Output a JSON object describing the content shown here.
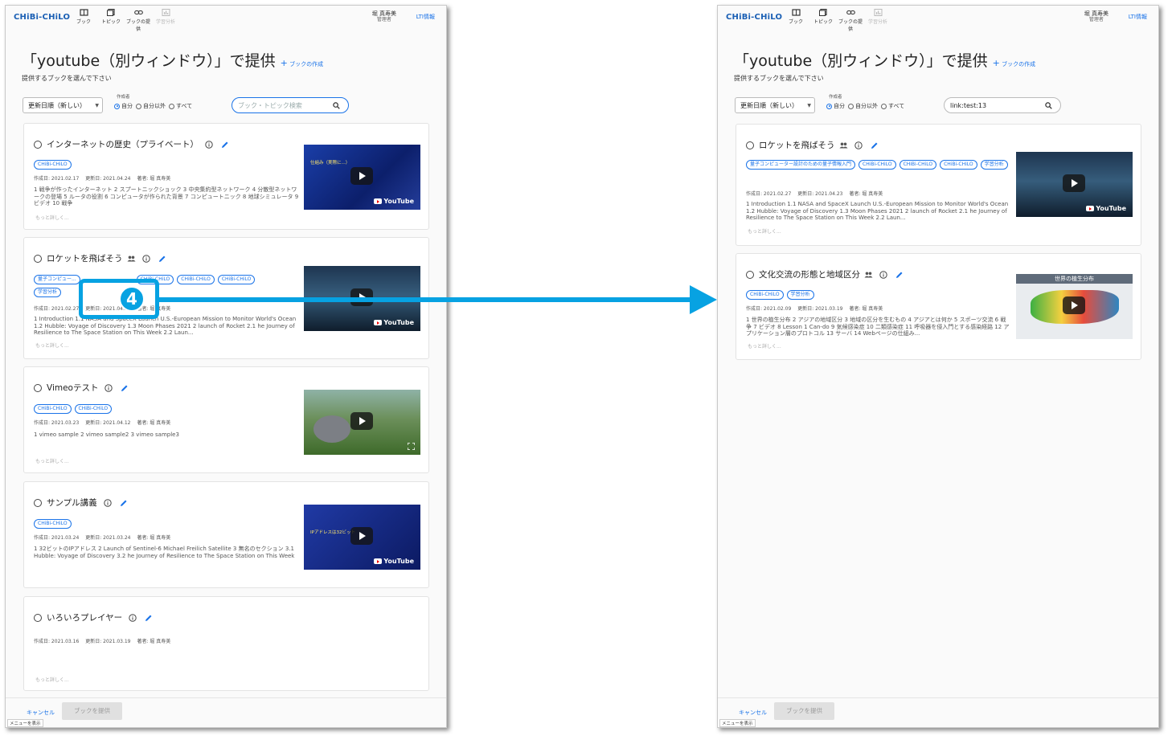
{
  "app": {
    "logo": "CHiBi-CHiLO",
    "nav": [
      {
        "label": "ブック",
        "icon": "book-icon",
        "enabled": true
      },
      {
        "label": "トピック",
        "icon": "topic-icon",
        "enabled": true
      },
      {
        "label": "ブックの提供",
        "icon": "link-icon",
        "enabled": true
      },
      {
        "label": "学習分析",
        "icon": "analytics-icon",
        "enabled": false
      }
    ],
    "user_name": "堀 真寿美",
    "user_role": "管理者",
    "lti_link": "LTI情報"
  },
  "page": {
    "title": "「youtube（別ウィンドウ）」で提供",
    "create_label": "ブックの作成",
    "subtitle": "提供するブックを選んで下さい"
  },
  "filters": {
    "sort_value": "更新日順（新しい）",
    "author_label": "作成者",
    "author_options": [
      "自分",
      "自分以外",
      "すべて"
    ],
    "author_selected": "自分",
    "search_placeholder": "ブック・トピック検索"
  },
  "left": {
    "search_value": "",
    "cards": [
      {
        "title": "インターネットの歴史（プライベート）",
        "tags": [
          "CHiBi-CHiLO"
        ],
        "created": "作成日: 2021.02.17",
        "updated": "更新日: 2021.04.24",
        "author": "著者: 堀 真寿美",
        "desc": "1 戦争が作ったインターネット 2 スプートニックショック 3 中央集約型ネットワーク 4 分散型ネットワークの登場 5 ルータの役割 6 コンピュータが作られた背景 7 コンピュートニック 8 地球シミュレータ 9 ビデオ 10 戦争",
        "more": "もっと詳しく...",
        "thumb_text": "仕組み（実際に...）",
        "video": "YouTube"
      },
      {
        "title": "ロケットを飛ばそう",
        "tags": [
          "量子コンピュー...",
          "CHiBi-CHiLO",
          "CHiBi-CHiLO",
          "CHiBi-CHiLO",
          "学習分析"
        ],
        "created": "作成日: 2021.02.27",
        "updated": "更新日: 2021.04.23",
        "author": "著者: 堀 真寿美",
        "desc": "1 Introduction 1.1 NASA and SpaceX Launch U.S.-European Mission to Monitor World's Ocean 1.2 Hubble: Voyage of Discovery 1.3 Moon Phases 2021 2 launch of Rocket 2.1 he Journey of Resilience to The Space Station on This Week 2.2 Laun...",
        "more": "もっと詳しく...",
        "video": "YouTube"
      },
      {
        "title": "Vimeoテスト",
        "tags": [
          "CHiBi-CHiLO",
          "CHiBi-CHiLO"
        ],
        "created": "作成日: 2021.03.23",
        "updated": "更新日: 2021.04.12",
        "author": "著者: 堀 真寿美",
        "desc": "1 vimeo sample 2 vimeo sample2 3 vimeo sample3",
        "more": "もっと詳しく..."
      },
      {
        "title": "サンプル講義",
        "tags": [
          "CHiBi-CHiLO"
        ],
        "created": "作成日: 2021.03.24",
        "updated": "更新日: 2021.03.24",
        "author": "著者: 堀 真寿美",
        "desc": "1 32ビットのIPアドレス 2 Launch of Sentinel-6 Michael Freilich Satellite 3 無名のセクション 3.1 Hubble: Voyage of Discovery 3.2 he Journey of Resilience to The Space Station on This Week",
        "more": "もっと詳しく...",
        "thumb_text": "IPアドレスは32ビット",
        "video": "YouTube"
      },
      {
        "title": "いろいろプレイヤー",
        "tags": [],
        "created": "作成日: 2021.03.16",
        "updated": "更新日: 2021.03.19",
        "author": "著者: 堀 真寿美",
        "desc": "",
        "more": "もっと詳しく..."
      }
    ]
  },
  "right": {
    "search_value": "link:test:13",
    "cards": [
      {
        "title": "ロケットを飛ばそう",
        "tags": [
          "量子コンピューター設計のための量子情報入門",
          "CHiBi-CHiLO",
          "CHiBi-CHiLO",
          "CHiBi-CHiLO",
          "学習分析"
        ],
        "created": "作成日: 2021.02.27",
        "updated": "更新日: 2021.04.23",
        "author": "著者: 堀 真寿美",
        "desc": "1 Introduction 1.1 NASA and SpaceX Launch U.S.-European Mission to Monitor World's Ocean 1.2 Hubble: Voyage of Discovery 1.3 Moon Phases 2021 2 launch of Rocket 2.1 he Journey of Resilience to The Space Station on This Week 2.2 Laun...",
        "more": "もっと詳しく...",
        "video": "YouTube"
      },
      {
        "title": "文化交流の形態と地域区分",
        "tags": [
          "CHiBi-CHiLO",
          "学習分析"
        ],
        "created": "作成日: 2021.02.09",
        "updated": "更新日: 2021.03.19",
        "author": "著者: 堀 真寿美",
        "desc": "1 世界の植生分布 2 アジアの地域区分 3 地域の区分を生むもの 4 アジアとは何か 5 スポーツ交流 6 戦争 7 ビデオ 8 Lesson 1 Can-do 9 気候感染症 10 二類感染症 11 呼吸器を侵入門とする感染経路 12 アプリケーション層のプロトコル 13 サーバ 14 Webページの仕組み...",
        "more": "もっと詳しく...",
        "thumb_text": "世界の植生分布"
      }
    ]
  },
  "footer": {
    "cancel": "キャンセル",
    "provide": "ブックを提供",
    "menu_tip": "メニューを表示"
  },
  "annotation": {
    "step": "4",
    "color": "#07a2e2"
  },
  "colors": {
    "accent": "#1a73e8",
    "brand": "#1a5fb4",
    "annotation": "#07a2e2"
  }
}
